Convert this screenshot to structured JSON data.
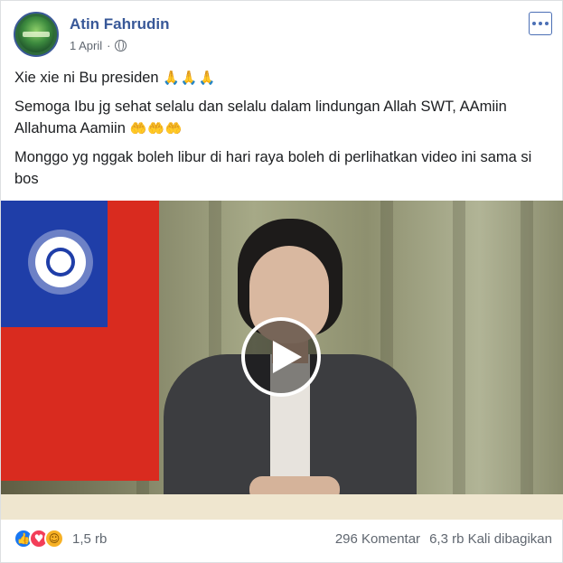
{
  "post": {
    "author": "Atin Fahrudin",
    "date": "1 April",
    "date_separator": "·",
    "privacy_icon": "globe-icon",
    "more_icon": "more-options-icon",
    "paragraphs": [
      {
        "text": "Xie xie ni Bu presiden ",
        "emoji": "🙏🙏🙏"
      },
      {
        "text": "Semoga Ibu jg sehat selalu dan selalu dalam lindungan Allah SWT, AAmiin Allahuma Aamiin ",
        "emoji": "🤲🤲🤲"
      },
      {
        "text": "Monggo yg nggak boleh libur di hari raya boleh di perlihatkan video ini sama si bos",
        "emoji": ""
      }
    ]
  },
  "video": {
    "play_icon": "play-icon"
  },
  "footer": {
    "reaction_icons": [
      "like-icon",
      "love-icon",
      "care-icon"
    ],
    "reaction_glyphs": [
      "👍",
      "♥",
      "☺"
    ],
    "reaction_count": "1,5 rb",
    "comments": "296 Komentar",
    "shares": "6,3 rb Kali dibagikan"
  },
  "colors": {
    "author": "#385898",
    "meta": "#606770",
    "like": "#1877f2",
    "love": "#f33e58",
    "care": "#f7b125"
  }
}
